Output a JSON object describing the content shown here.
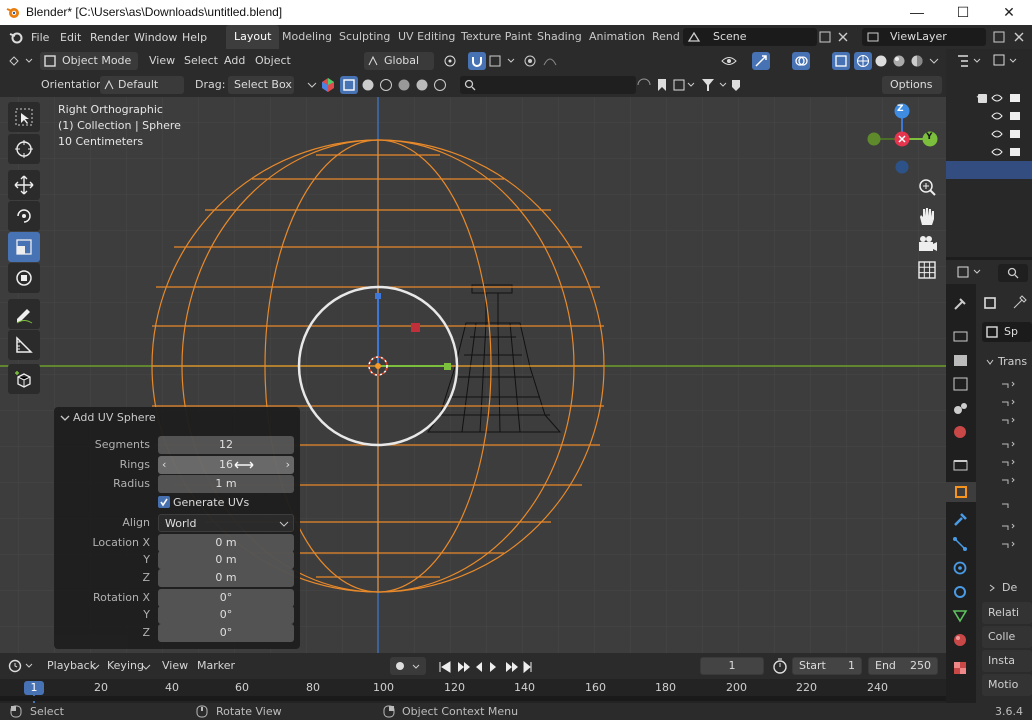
{
  "window": {
    "title": "Blender* [C:\\Users\\as\\Downloads\\untitled.blend]",
    "minimize": "—",
    "maximize": "☐",
    "close": "✕"
  },
  "menu": {
    "items": [
      "File",
      "Edit",
      "Render",
      "Window",
      "Help"
    ]
  },
  "workspaces": {
    "tabs": [
      "Layout",
      "Modeling",
      "Sculpting",
      "UV Editing",
      "Texture Paint",
      "Shading",
      "Animation",
      "Rend"
    ],
    "active": "Layout"
  },
  "scene": {
    "name": "Scene",
    "view_layer": "ViewLayer"
  },
  "header": {
    "mode": "Object Mode",
    "view": "View",
    "select": "Select",
    "add": "Add",
    "object": "Object",
    "transform": "Global"
  },
  "header2": {
    "orientation_label": "Orientation:",
    "orientation_value": "Default",
    "drag_label": "Drag:",
    "drag_value": "Select Box",
    "options": "Options"
  },
  "viewport": {
    "line1": "Right Orthographic",
    "line2": "(1) Collection | Sphere",
    "line3": "10 Centimeters"
  },
  "gizmo": {
    "z": "Z",
    "y": "Y"
  },
  "redo_panel": {
    "title": "Add UV Sphere",
    "segments_label": "Segments",
    "segments": "12",
    "rings_label": "Rings",
    "rings": "16",
    "radius_label": "Radius",
    "radius": "1 m",
    "generate_uvs": "Generate UVs",
    "align_label": "Align",
    "align": "World",
    "location_label": "Location X",
    "loc_x": "0 m",
    "y_label": "Y",
    "loc_y": "0 m",
    "z_label": "Z",
    "loc_z": "0 m",
    "rotation_label": "Rotation X",
    "rot_x": "0°",
    "rot_y": "0°",
    "rot_z": "0°"
  },
  "timeline": {
    "playback": "Playback",
    "keying": "Keying",
    "view": "View",
    "marker": "Marker",
    "current_frame": "1",
    "start_label": "Start",
    "start": "1",
    "end_label": "End",
    "end": "250",
    "ruler": [
      "1",
      "20",
      "40",
      "60",
      "80",
      "100",
      "120",
      "140",
      "160",
      "180",
      "200",
      "220",
      "240"
    ]
  },
  "status": {
    "select": "Select",
    "rotate": "Rotate View",
    "context": "Object Context Menu",
    "version": "3.6.4"
  },
  "properties": {
    "object_short": "Sp",
    "sections": [
      "Trans",
      "De",
      "Relati",
      "Colle",
      "Insta",
      "Motio"
    ]
  },
  "colors": {
    "accent": "#4772b3",
    "selection": "#f7941d",
    "axis_x": "#e4344e",
    "axis_y": "#7bbf3c",
    "axis_z": "#3e8de3"
  }
}
